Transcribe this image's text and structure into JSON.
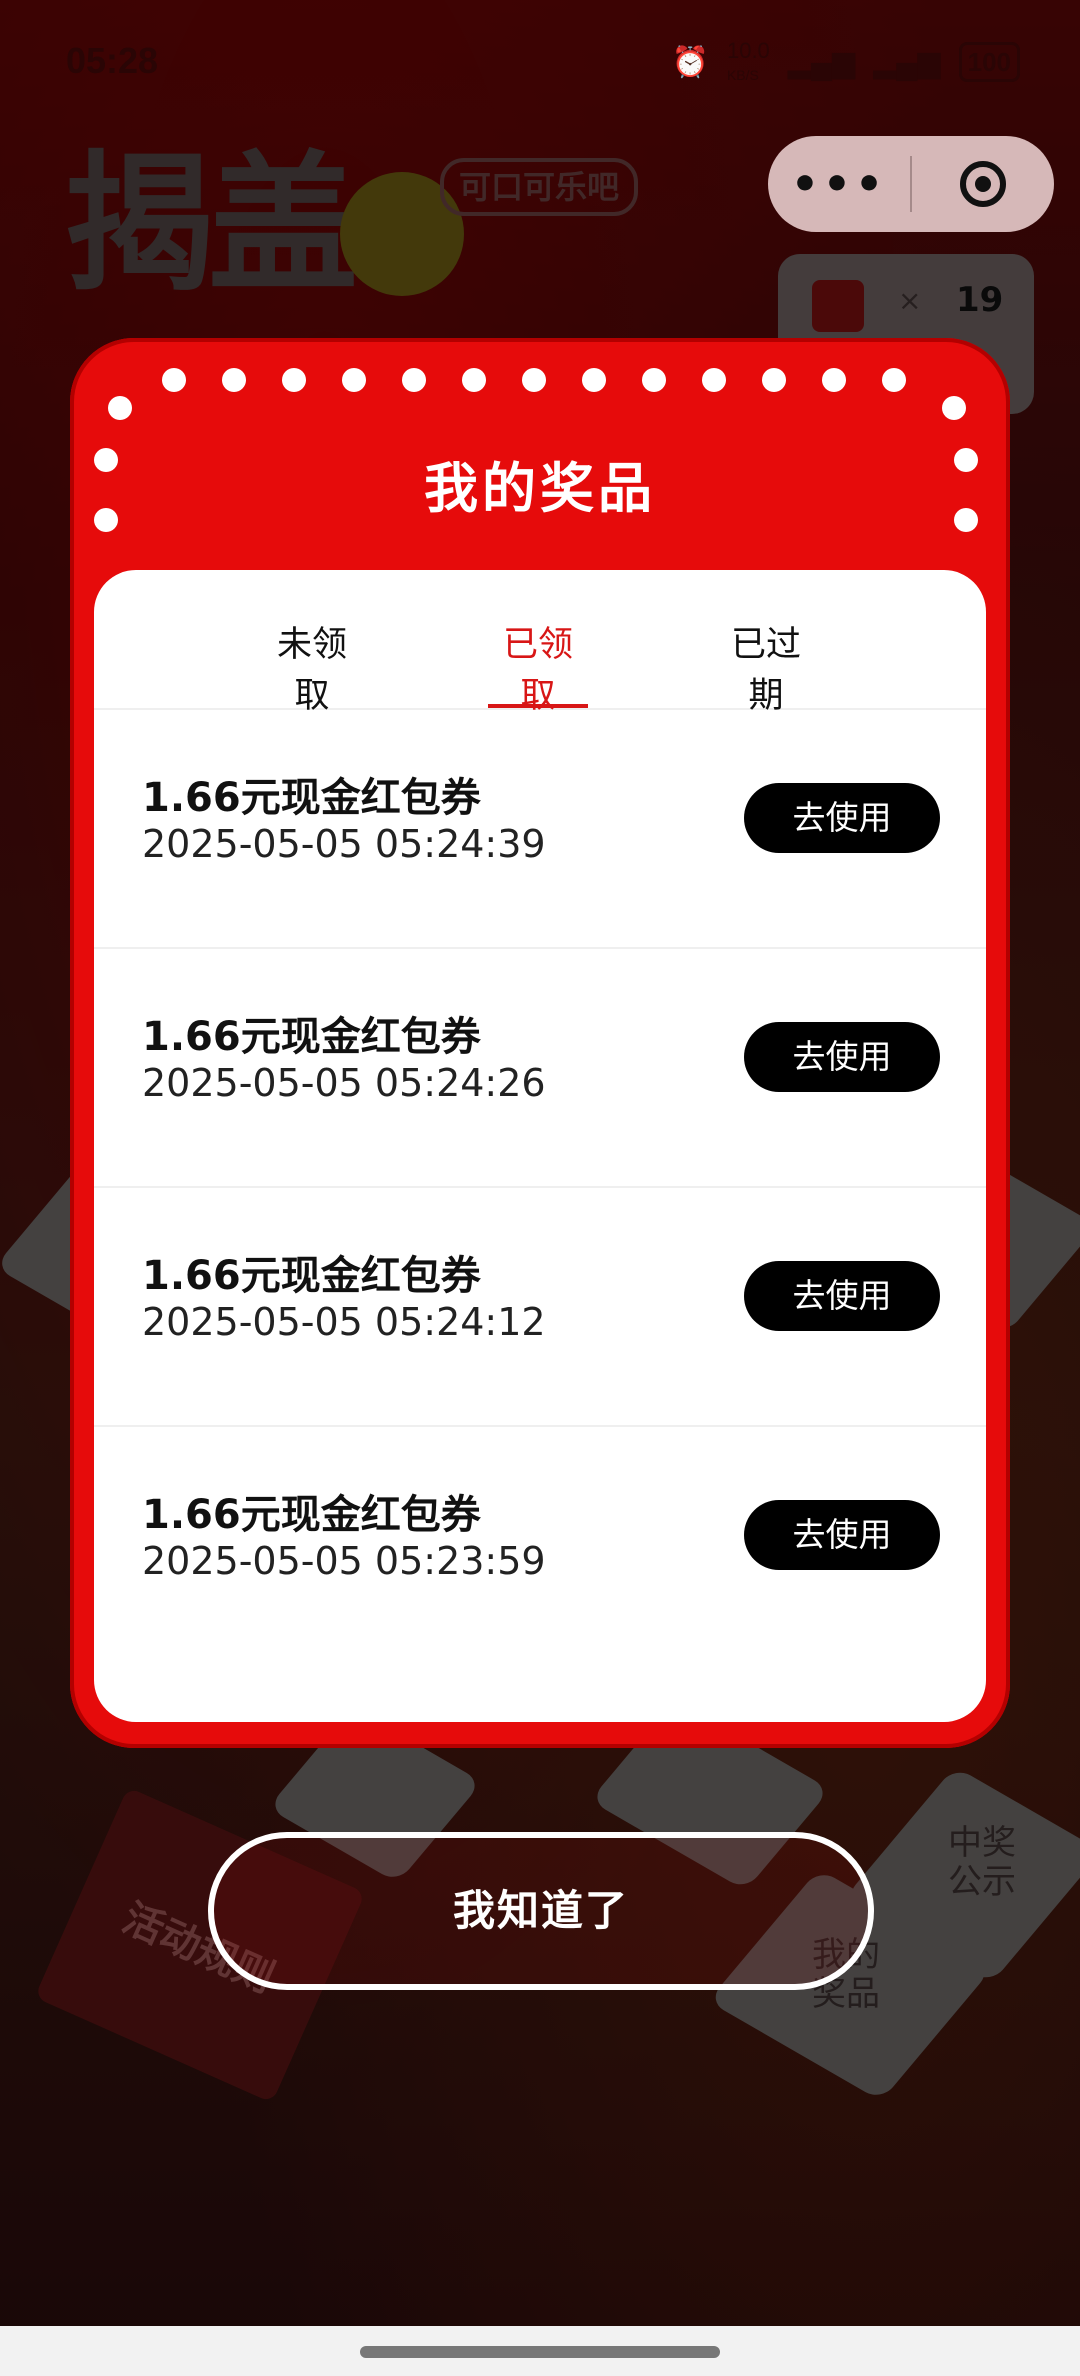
{
  "status_bar": {
    "time": "05:28",
    "network_speed": "10.0",
    "network_unit": "KB/S",
    "battery": "100",
    "icons": [
      "alarm-icon",
      "5g-signal-icon",
      "5g-signal-icon",
      "battery-icon"
    ]
  },
  "mini_program_capsule": {
    "more": "•••",
    "icons": [
      "more-icon",
      "close-target-icon"
    ]
  },
  "background": {
    "game_title": "揭盖",
    "brand": "可口可乐吧",
    "counter_times": "×",
    "counter_value": "19",
    "rules_label": "活动规则",
    "winners_label": "中奖公示",
    "my_prize_label": "我的奖品"
  },
  "modal": {
    "title": "我的奖品",
    "tabs": [
      {
        "label": "未领取",
        "active": false
      },
      {
        "label": "已领取",
        "active": true
      },
      {
        "label": "已过期",
        "active": false
      }
    ],
    "prizes": [
      {
        "name": "1.66元现金红包券",
        "time": "2025-05-05 05:24:39",
        "action": "去使用"
      },
      {
        "name": "1.66元现金红包券",
        "time": "2025-05-05 05:24:26",
        "action": "去使用"
      },
      {
        "name": "1.66元现金红包券",
        "time": "2025-05-05 05:24:12",
        "action": "去使用"
      },
      {
        "name": "1.66元现金红包券",
        "time": "2025-05-05 05:23:59",
        "action": "去使用"
      }
    ],
    "confirm_label": "我知道了"
  },
  "colors": {
    "modal_red": "#e60b0b",
    "active_tab": "#d81616",
    "button_black": "#000000"
  }
}
